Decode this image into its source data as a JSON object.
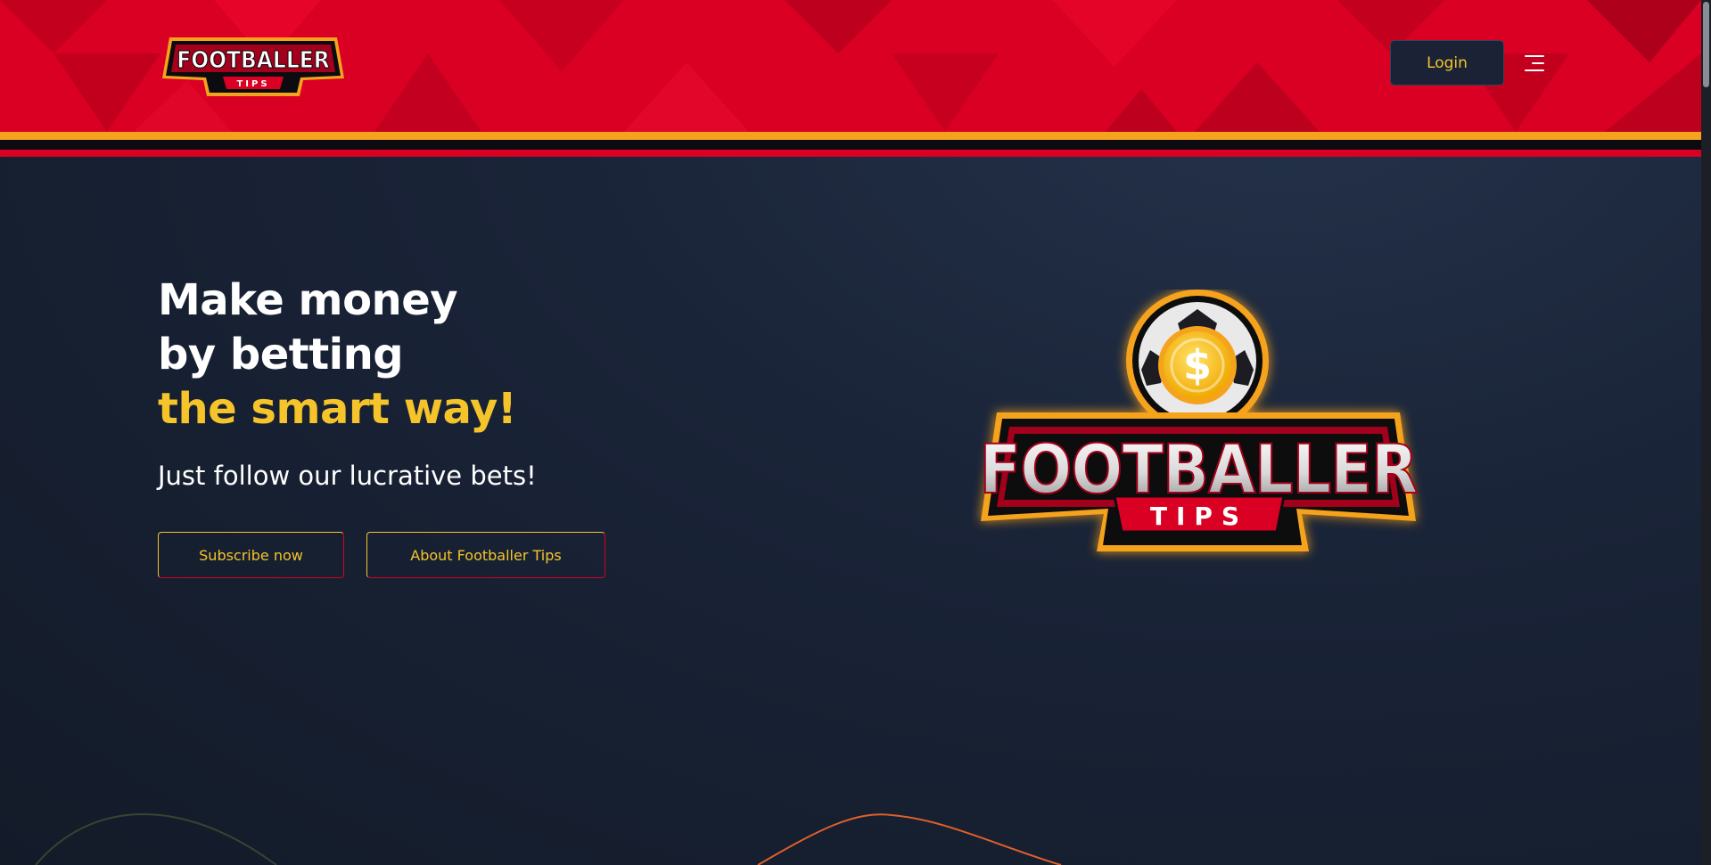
{
  "header": {
    "logo": {
      "word": "FOOTBALLER",
      "sub": "TIPS"
    },
    "login_label": "Login",
    "menu_icon": "hamburger-menu-icon"
  },
  "hero": {
    "headline_line1": "Make money",
    "headline_line2": "by betting",
    "headline_accent": "the smart way!",
    "subline": "Just follow our lucrative bets!",
    "subscribe_label": "Subscribe now",
    "about_label": "About Footballer Tips",
    "logo": {
      "word": "FOOTBALLER",
      "sub": "TIPS",
      "coin_symbol": "$"
    }
  },
  "colors": {
    "brand_red": "#d90023",
    "brand_yellow": "#f5c42b",
    "brand_orange": "#f5a31f",
    "background_navy": "#1a2438"
  }
}
